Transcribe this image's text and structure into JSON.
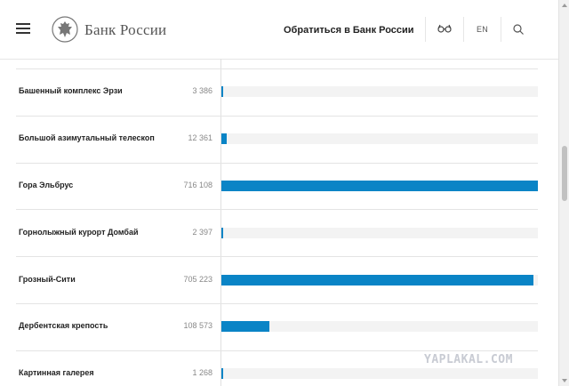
{
  "header": {
    "logo_text": "Банк России",
    "contact_link": "Обратиться в Банк России",
    "lang": "EN"
  },
  "icons": {
    "menu": "hamburger-menu-icon",
    "emblem": "double-headed-eagle-icon",
    "accessibility": "glasses-icon",
    "search": "search-icon"
  },
  "colors": {
    "bar": "#0a84c6",
    "track": "#f3f3f3"
  },
  "watermark": "YAPLAKAL.COM",
  "chart_data": {
    "type": "bar",
    "orientation": "horizontal",
    "grid": false,
    "xlim": [
      0,
      716108
    ],
    "categories": [
      "Башенный комплекс Эрзи",
      "Большой азимутальный телескоп",
      "Гора Эльбрус",
      "Горнолыжный курорт Домбай",
      "Грозный-Сити",
      "Дербентская крепость",
      "Картинная галерея"
    ],
    "value_labels": [
      "3 386",
      "12 361",
      "716 108",
      "2 397",
      "705 223",
      "108 573",
      "1 268"
    ],
    "values": [
      3386,
      12361,
      716108,
      2397,
      705223,
      108573,
      1268
    ]
  }
}
